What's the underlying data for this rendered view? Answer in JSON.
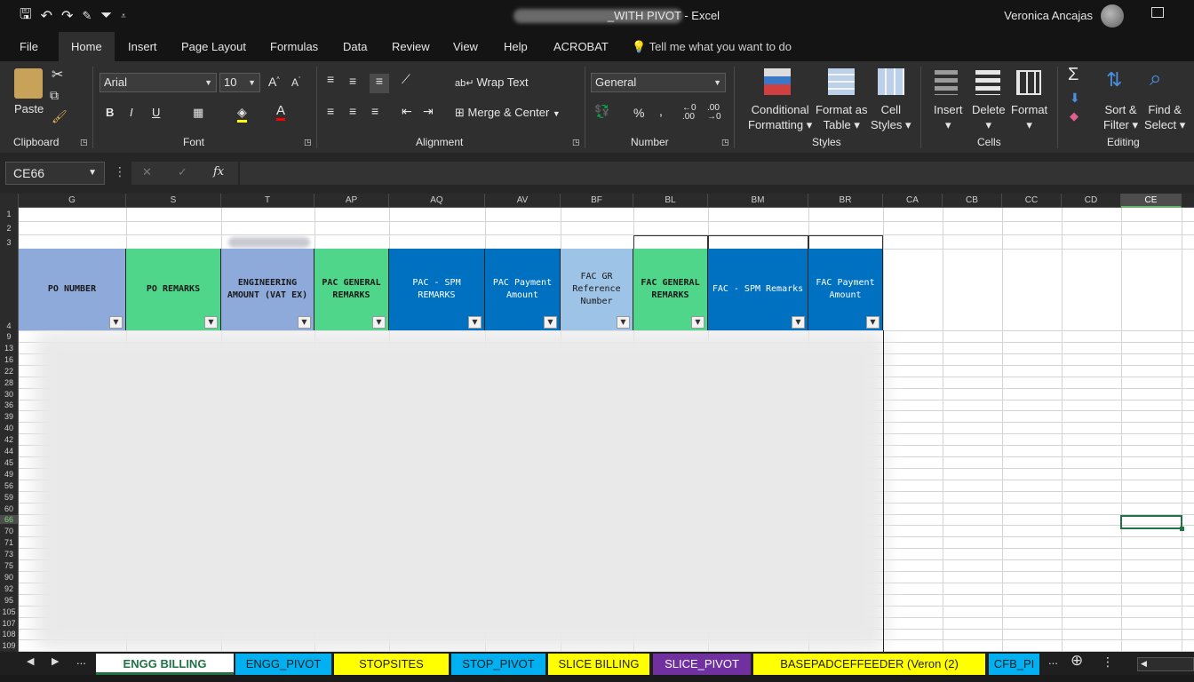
{
  "window": {
    "title": "_WITH PIVOT  -  Excel",
    "user_name": "Veronica Ancajas"
  },
  "menu_tabs": [
    "File",
    "Home",
    "Insert",
    "Page Layout",
    "Formulas",
    "Data",
    "Review",
    "View",
    "Help",
    "ACROBAT"
  ],
  "tell_me": "Tell me what you want to do",
  "ribbon": {
    "clipboard": {
      "paste": "Paste",
      "label": "Clipboard"
    },
    "font": {
      "name": "Arial",
      "size": "10",
      "bold": "B",
      "italic": "I",
      "underline": "U",
      "label": "Font"
    },
    "alignment": {
      "wrap_text": "Wrap Text",
      "merge_center": "Merge & Center",
      "label": "Alignment"
    },
    "number": {
      "format": "General",
      "percent": "%",
      "comma": ",",
      "label": "Number"
    },
    "styles": {
      "conditional_1": "Conditional",
      "conditional_2": "Formatting",
      "format_table_1": "Format as",
      "format_table_2": "Table",
      "cell_styles_1": "Cell",
      "cell_styles_2": "Styles",
      "label": "Styles"
    },
    "cells": {
      "insert": "Insert",
      "delete": "Delete",
      "format": "Format",
      "label": "Cells"
    },
    "editing": {
      "sort_1": "Sort &",
      "sort_2": "Filter",
      "find_1": "Find &",
      "find_2": "Select",
      "label": "Editing"
    }
  },
  "formula_bar": {
    "name_box": "CE66",
    "fx": "fx",
    "cancel": "✕",
    "enter": "✓",
    "value": ""
  },
  "columns": [
    "G",
    "S",
    "T",
    "AP",
    "AQ",
    "AV",
    "BF",
    "BL",
    "BM",
    "BR",
    "CA",
    "CB",
    "CC",
    "CD",
    "CE"
  ],
  "selected_column": "CE",
  "row_numbers": [
    "1",
    "2",
    "3",
    "4",
    "9",
    "13",
    "16",
    "22",
    "28",
    "30",
    "36",
    "39",
    "40",
    "42",
    "44",
    "45",
    "49",
    "56",
    "59",
    "60",
    "66",
    "70",
    "71",
    "73",
    "75",
    "90",
    "92",
    "95",
    "105",
    "107",
    "108",
    "109"
  ],
  "header_cells": [
    {
      "text": "PO NUMBER",
      "color": "#8eaadb"
    },
    {
      "text": "PO REMARKS",
      "color": "#4fd68a"
    },
    {
      "text": "ENGINEERING AMOUNT (VAT EX)",
      "color": "#8eaadb"
    },
    {
      "text": "PAC GENERAL REMARKS",
      "color": "#4fd68a"
    },
    {
      "text": "PAC - SPM REMARKS",
      "color": "#0070c0"
    },
    {
      "text": "PAC Payment Amount",
      "color": "#0070c0"
    },
    {
      "text": "FAC GR Reference Number",
      "color": "#9dc3e6"
    },
    {
      "text": "FAC GENERAL REMARKS",
      "color": "#4fd68a"
    },
    {
      "text": "FAC - SPM Remarks",
      "color": "#0070c0"
    },
    {
      "text": "FAC Payment Amount",
      "color": "#0070c0"
    }
  ],
  "sheet_tabs": [
    {
      "label": "ENGG BILLING",
      "bg": "#ffffff",
      "fg": "#217346",
      "active": true
    },
    {
      "label": "ENGG_PIVOT",
      "bg": "#00b0f0",
      "fg": "#1f1f1f"
    },
    {
      "label": "STOPSITES",
      "bg": "#ffff00",
      "fg": "#1f1f1f"
    },
    {
      "label": "STOP_PIVOT",
      "bg": "#00b0f0",
      "fg": "#1f1f1f"
    },
    {
      "label": "SLICE BILLING",
      "bg": "#ffff00",
      "fg": "#1f1f1f"
    },
    {
      "label": "SLICE_PIVOT",
      "bg": "#7030a0",
      "fg": "#ffffff"
    },
    {
      "label": "BASEPADCEFFEEDER (Veron (2)",
      "bg": "#ffff00",
      "fg": "#1f1f1f"
    },
    {
      "label": "CFB_PI",
      "bg": "#00b0f0",
      "fg": "#1f1f1f"
    }
  ],
  "sheet_nav": {
    "ellipsis": "...",
    "add": "⊕"
  }
}
